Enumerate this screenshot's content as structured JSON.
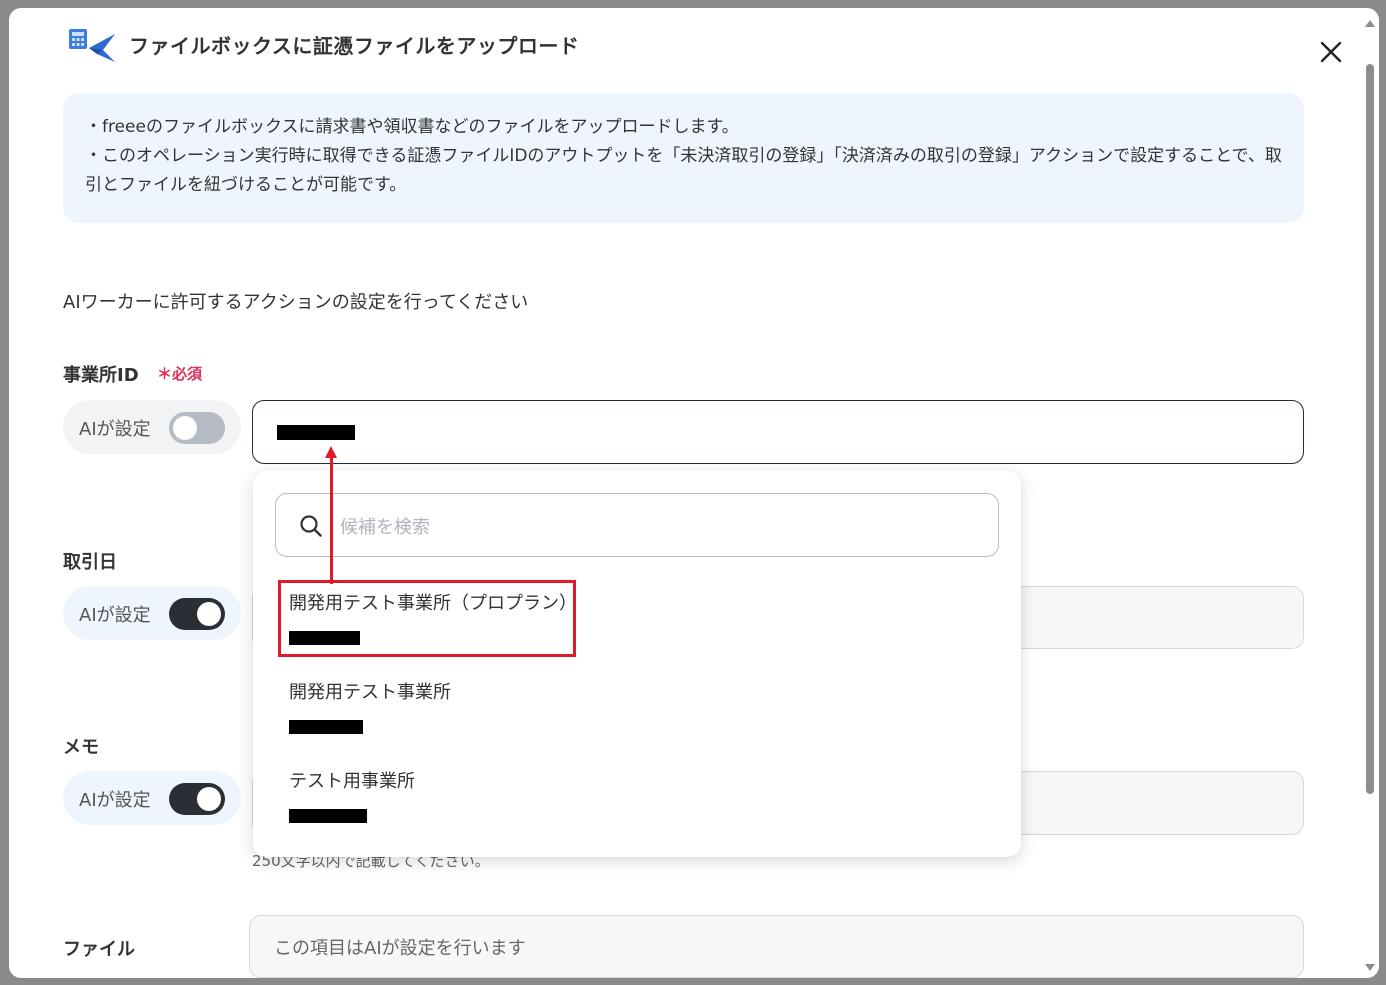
{
  "modal": {
    "title": "ファイルボックスに証憑ファイルをアップロード",
    "info_lines": [
      "・freeeのファイルボックスに請求書や領収書などのファイルをアップロードします。",
      "・このオペレーション実行時に取得できる証憑ファイルIDのアウトプットを「未決済取引の登録」「決済済みの取引の登録」アクションで設定することで、取引とファイルを紐づけることが可能です。"
    ],
    "section_lead": "AIワーカーに許可するアクションの設定を行ってください"
  },
  "fields": {
    "office_id": {
      "label": "事業所ID",
      "required_label": "＊必須",
      "ai_label": "AIが設定",
      "ai_enabled": false
    },
    "transaction_date": {
      "label": "取引日",
      "ai_label": "AIが設定",
      "ai_enabled": true
    },
    "memo": {
      "label": "メモ",
      "ai_label": "AIが設定",
      "ai_enabled": true,
      "helper": "250文字以内で記載してください。"
    },
    "file": {
      "label": "ファイル",
      "placeholder": "この項目はAIが設定を行います"
    }
  },
  "dropdown": {
    "search_placeholder": "候補を検索",
    "options": [
      {
        "name": "開発用テスト事業所（プロプラン）",
        "highlighted": true
      },
      {
        "name": "開発用テスト事業所",
        "highlighted": false
      },
      {
        "name": "テスト用事業所",
        "highlighted": false
      }
    ]
  },
  "colors": {
    "accent_red": "#e0192b",
    "required_pink": "#e0305a",
    "info_bg": "#eef5fd",
    "toggle_on": "#2a2f36",
    "toggle_off": "#b5bcc4"
  },
  "icons": [
    "freee-upload-logo-icon",
    "close-icon",
    "search-icon"
  ]
}
